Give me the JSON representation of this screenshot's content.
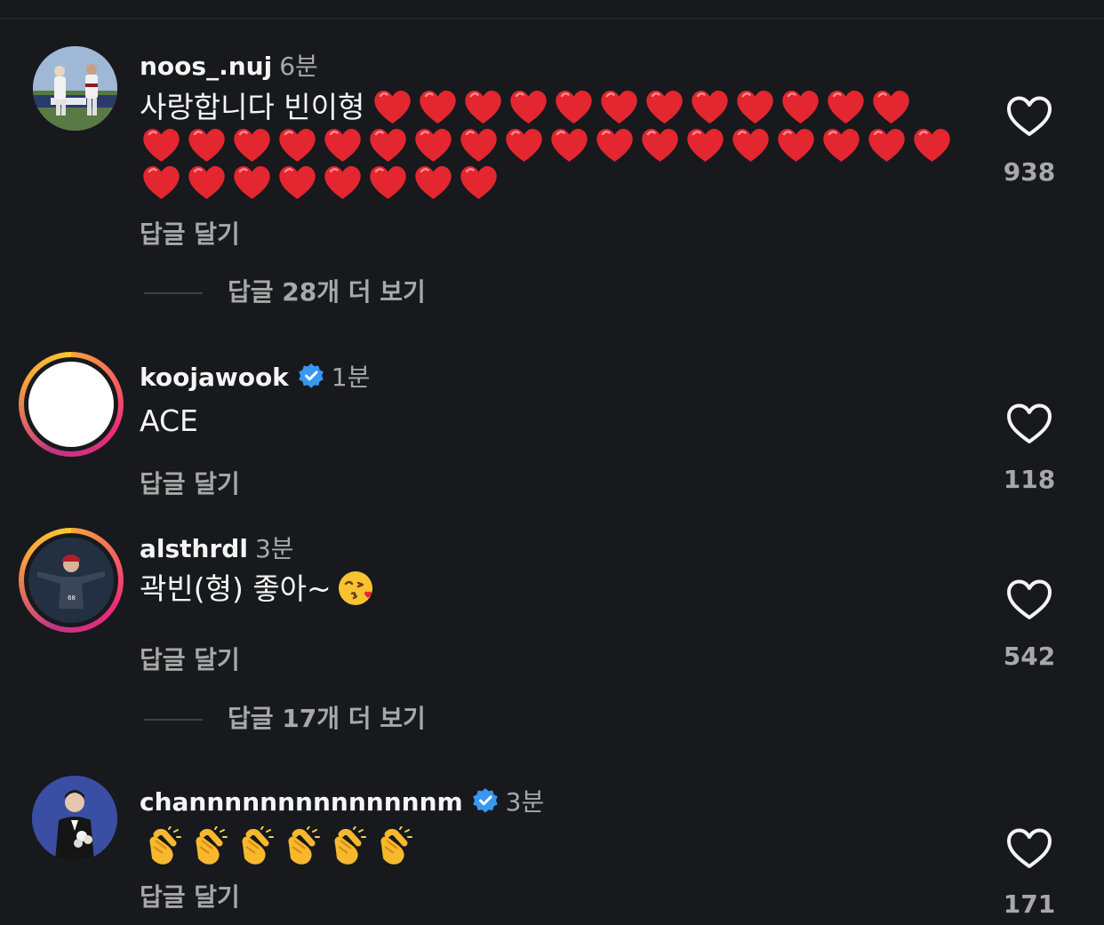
{
  "comments": [
    {
      "username": "noos_.nuj",
      "time": "6분",
      "text": "사랑합니다 빈이형",
      "emoji": "red-heart-emoji",
      "emoji_count": 38,
      "reply_label": "답글 달기",
      "more_replies": "답글 28개 더 보기",
      "likes": "938",
      "avatar": "baseball-players-photo"
    },
    {
      "username": "koojawook",
      "verified": true,
      "time": "1분",
      "text": "ACE",
      "reply_label": "답글 달기",
      "likes": "118",
      "avatar": "blank-white-avatar-story-ring"
    },
    {
      "username": "alsthrdl",
      "time": "3분",
      "text": "곽빈(형) 좋아~",
      "emoji": "face-blowing-kiss-emoji",
      "reply_label": "답글 달기",
      "more_replies": "답글 17개 더 보기",
      "likes": "542",
      "avatar": "pitcher-celebrating-story-ring"
    },
    {
      "username": "channnnnnnnnnnnnnm",
      "verified": true,
      "time": "3분",
      "emoji": "clapping-hands-emoji",
      "emoji_count": 6,
      "reply_label": "답글 달기",
      "likes": "171",
      "avatar": "man-with-flowers-photo"
    }
  ],
  "colors": {
    "background": "#17191d",
    "primary_text": "#f5f5f5",
    "secondary_text": "#a8a8a8",
    "verified_badge": "#3897f0",
    "heart_emoji": "#e3262f",
    "story_ring": [
      "#f9a43b",
      "#ee2a7b",
      "#c13584"
    ]
  }
}
